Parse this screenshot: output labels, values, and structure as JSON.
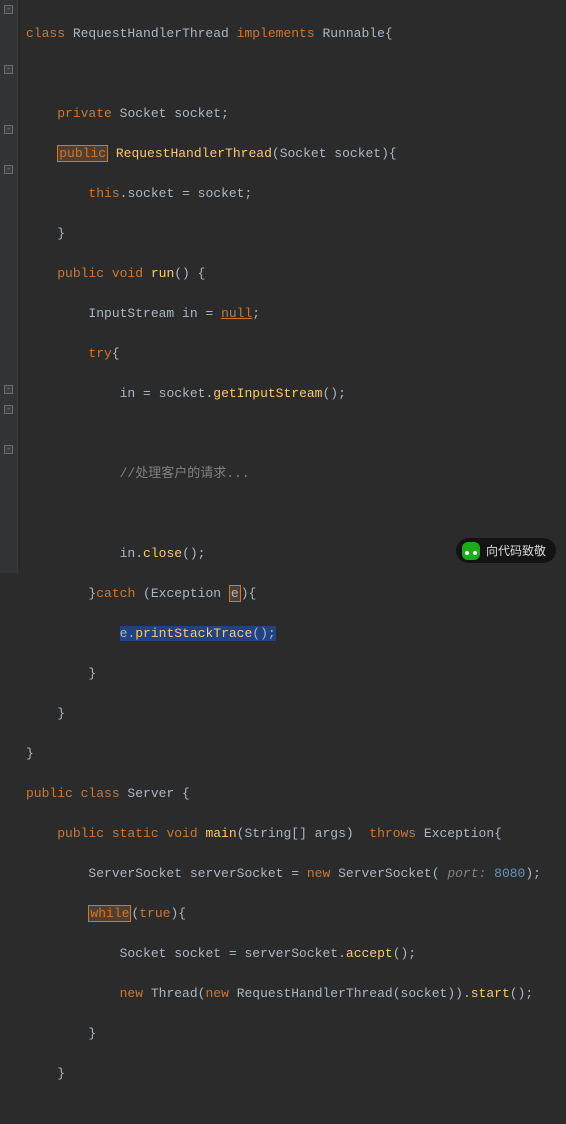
{
  "code": {
    "l1": {
      "kw_class": "class ",
      "name": "RequestHandlerThread ",
      "kw_impl": "implements ",
      "iface": "Runnable",
      "brace": "{"
    },
    "l3": {
      "pad": "    ",
      "kw_priv": "private ",
      "type": "Socket ",
      "var": "socket",
      "end": ";"
    },
    "l4": {
      "pad": "    ",
      "kw_pub": "public",
      "sp": " ",
      "name": "RequestHandlerThread",
      "paren": "(",
      "ptype": "Socket ",
      "pname": "socket",
      "end": "){"
    },
    "l5": {
      "pad": "        ",
      "kw_this": "this",
      "dot": ".",
      "field": "socket",
      "eq": " = ",
      "var": "socket",
      "end": ";"
    },
    "l6": {
      "pad": "    ",
      "brace": "}"
    },
    "l7": {
      "pad": "    ",
      "kw_pub": "public ",
      "kw_void": "void ",
      "name": "run",
      "end": "() {"
    },
    "l8": {
      "pad": "        ",
      "type": "InputStream ",
      "var": "in",
      "eq": " = ",
      "val": "null",
      "end": ";"
    },
    "l9": {
      "pad": "        ",
      "kw_try": "try",
      "brace": "{"
    },
    "l10": {
      "pad": "            ",
      "var": "in",
      "eq": " = ",
      "obj": "socket",
      "dot": ".",
      "mth": "getInputStream",
      "end": "();"
    },
    "l12": {
      "pad": "            ",
      "cmt": "//处理客户的请求..."
    },
    "l14": {
      "pad": "            ",
      "var": "in",
      "dot": ".",
      "mth": "close",
      "end": "();"
    },
    "l15": {
      "pad": "        ",
      "brace1": "}",
      "kw_catch": "catch ",
      "paren": "(",
      "type": "Exception ",
      "var": "e",
      "end": "){"
    },
    "l16": {
      "pad": "            ",
      "var": "e",
      "dot": ".",
      "mth": "printStackTrace",
      "end": "();"
    },
    "l17": {
      "pad": "        ",
      "brace": "}"
    },
    "l18": {
      "pad": "    ",
      "brace": "}"
    },
    "l19": {
      "brace": "}"
    },
    "l20": {
      "kw_pub": "public ",
      "kw_class": "class ",
      "name": "Server ",
      "brace": "{"
    },
    "l21": {
      "pad": "    ",
      "kw_pub": "public ",
      "kw_static": "static ",
      "kw_void": "void ",
      "name": "main",
      "args": "(String[] args)  ",
      "kw_throws": "throws ",
      "exc": "Exception",
      "brace": "{"
    },
    "l22": {
      "pad": "        ",
      "type": "ServerSocket ",
      "var": "serverSocket",
      "eq": " = ",
      "kw_new": "new ",
      "ctor": "ServerSocket",
      "paren": "(",
      "hint": " port: ",
      "num": "8080",
      "end": ");"
    },
    "l23": {
      "pad": "        ",
      "kw_while": "while",
      "paren": "(",
      "val": "true",
      "end": "){"
    },
    "l24": {
      "pad": "            ",
      "type": "Socket ",
      "var": "socket",
      "eq": " = ",
      "obj": "serverSocket",
      "dot": ".",
      "mth": "accept",
      "end": "();"
    },
    "l25": {
      "pad": "            ",
      "kw_new": "new ",
      "type": "Thread",
      "paren": "(",
      "kw_new2": "new ",
      "ctor": "RequestHandlerThread",
      "paren2": "(",
      "arg": "socket",
      "end": ")).",
      "mth": "start",
      "end2": "();"
    },
    "l26": {
      "pad": "        ",
      "brace": "}"
    },
    "l27": {
      "pad": "    ",
      "brace": "}"
    }
  },
  "watermark": "向代码致敬"
}
